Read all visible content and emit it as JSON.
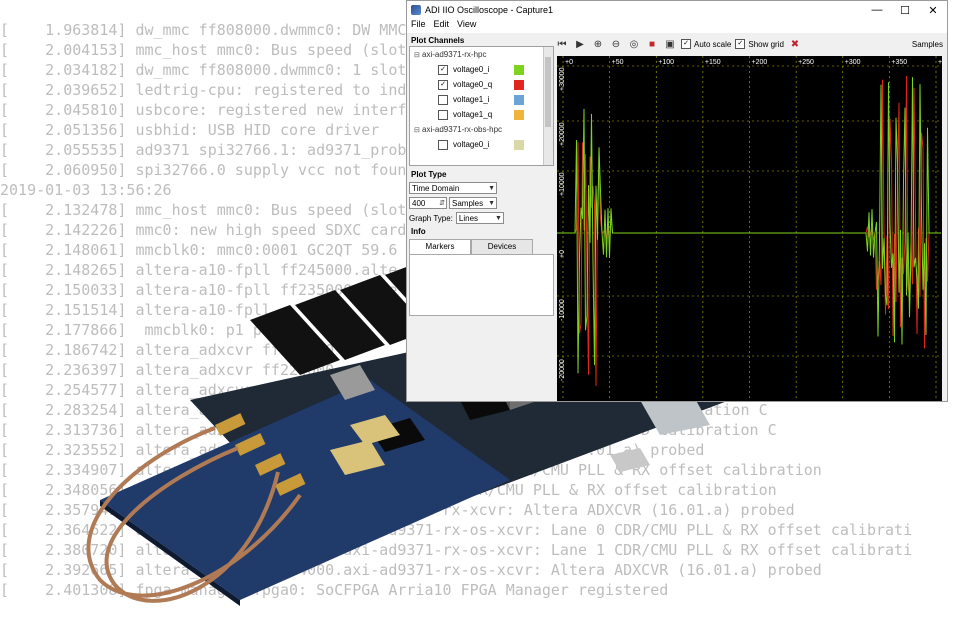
{
  "log_lines": [
    "[    1.963814] dw_mmc ff808000.dwmmc0: DW MMC",
    "[    2.004153] mmc_host mmc0: Bus speed (slot",
    "[    2.034182] dw_mmc ff808000.dwmmc0: 1 slot",
    "[    2.039652] ledtrig-cpu: registered to ind",
    "[    2.045810] usbcore: registered new interf",
    "[    2.051356] usbhid: USB HID core driver",
    "[    2.055535] ad9371 spi32766.1: ad9371_prob",
    "[    2.060950] spi32766.0 supply vcc not foun",
    "2019-01-03 13:56:26",
    "[    2.132478] mmc_host mmc0: Bus speed (slot",
    "[    2.142226] mmc0: new high speed SDXC card",
    "[    2.148061] mmcblk0: mmc0:0001 GC2QT 59.6",
    "[    2.148265] altera-a10-fpll ff245000.alte",
    "[    2.150033] altera-a10-fpll ff235000.alte",
    "[    2.151514] altera-a10-fpll",
    "[    2.177866]  mmcblk0: p1 p2",
    "[    2.186742] altera_adxcvr ff224000",
    "[    2.236397] altera_adxcvr ff224000",
    "[    2.254577] altera_adxcvr ff224000",
    "[    2.283254] altera_adxcvr                                 on and VOD calibration C",
    "[    2.313736] altera_adxcvr                                 ion and VOD calibration C",
    "[    2.323552] altera_adxcvr                                  (16.01.a) probed",
    "[    2.334907] altera_adxcvr                     xcvr:  CDR/CMU PLL & RX offset calibration",
    "[    2.348056] altera_adxcvr ff2  ad9371-rx-x      CDR/CMU PLL & RX offset calibration",
    "[    2.357941] altera_adxcvr ff234000.axi-ad9371-rx-xcvr: Altera ADXCVR (16.01.a) probed",
    "[    2.364622] altera_adxcvr ff244000.axi-ad9371-rx-os-xcvr: Lane 0 CDR/CMU PLL & RX offset calibrati",
    "[    2.380720] altera_adxcvr ff244000.axi-ad9371-rx-os-xcvr: Lane 1 CDR/CMU PLL & RX offset calibrati",
    "[    2.392665] altera_adxcvr ff244000.axi-ad9371-rx-os-xcvr: Altera ADXCVR (16.01.a) probed",
    "[    2.401308] fpga_manager fpga0: SoCFPGA Arria10 FPGA Manager registered"
  ],
  "window": {
    "title": "ADI IIO Oscilloscope - Capture1",
    "menu": [
      "File",
      "Edit",
      "View"
    ]
  },
  "plot_channels": {
    "label": "Plot Channels",
    "groups": [
      {
        "name": "axi-ad9371-rx-hpc",
        "channels": [
          {
            "name": "voltage0_i",
            "checked": true,
            "color": "#7ed321"
          },
          {
            "name": "voltage0_q",
            "checked": true,
            "color": "#e0261e"
          },
          {
            "name": "voltage1_i",
            "checked": false,
            "color": "#6ba3d6"
          },
          {
            "name": "voltage1_q",
            "checked": false,
            "color": "#f0b43c"
          }
        ]
      },
      {
        "name": "axi-ad9371-rx-obs-hpc",
        "channels": [
          {
            "name": "voltage0_i",
            "checked": false,
            "color": "#d9d9a8"
          }
        ]
      }
    ]
  },
  "plot_type": {
    "label": "Plot Type",
    "domain": "Time Domain",
    "samples_value": "400",
    "samples_unit": "Samples",
    "graph_type_label": "Graph Type:",
    "graph_type": "Lines"
  },
  "info": {
    "label": "Info",
    "tabs": [
      "Markers",
      "Devices"
    ]
  },
  "toolbar": {
    "auto_scale_label": "Auto scale",
    "auto_scale_checked": true,
    "show_grid_label": "Show grid",
    "show_grid_checked": true,
    "x_unit_label": "Samples"
  },
  "plot": {
    "x_ticks": [
      "+0",
      "+50",
      "+100",
      "+150",
      "+200",
      "+250",
      "+300",
      "+350",
      "+400"
    ],
    "y_ticks": [
      "+30000",
      "+20000",
      "+10000",
      "+0",
      "-10000",
      "-20000"
    ],
    "xlim": [
      0,
      400
    ],
    "background": "#000000",
    "grid_color": "#b8b800"
  }
}
